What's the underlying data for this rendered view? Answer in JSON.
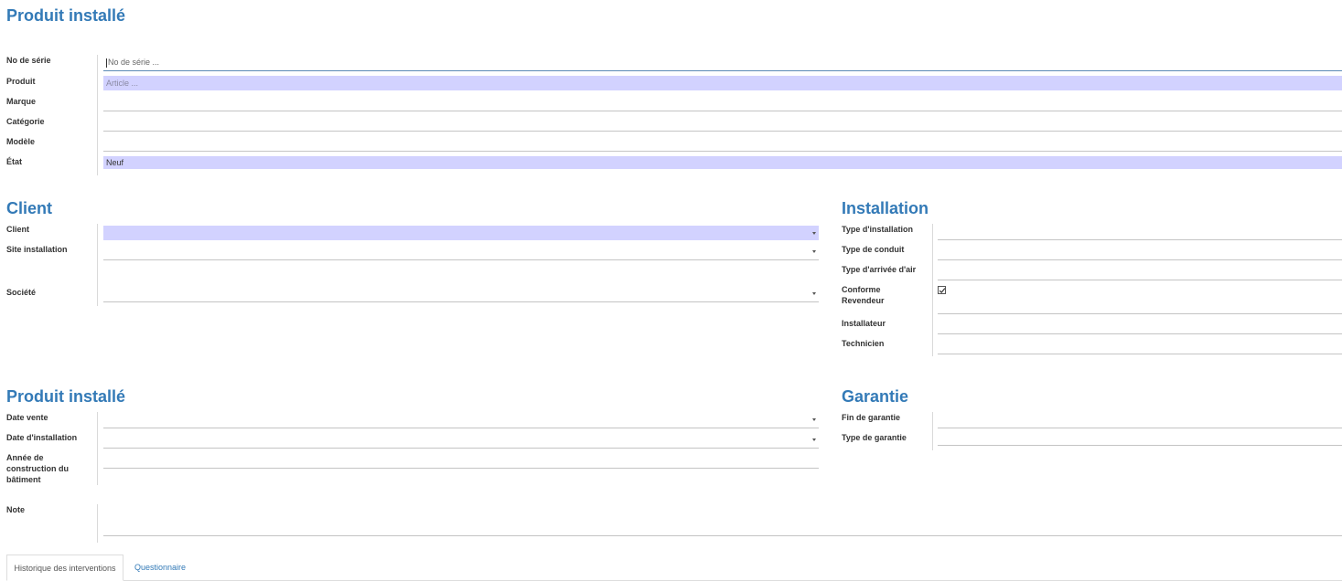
{
  "sections": {
    "product_main": "Produit installé",
    "client": "Client",
    "installation": "Installation",
    "product_sale": "Produit installé",
    "warranty": "Garantie"
  },
  "product": {
    "serial": {
      "label": "No de série",
      "placeholder": "No de série ..."
    },
    "product": {
      "label": "Produit",
      "placeholder": "Article ..."
    },
    "brand": {
      "label": "Marque",
      "value": ""
    },
    "category": {
      "label": "Catégorie",
      "value": ""
    },
    "model": {
      "label": "Modèle",
      "value": ""
    },
    "state": {
      "label": "État",
      "value": "Neuf"
    }
  },
  "client": {
    "client": {
      "label": "Client",
      "value": ""
    },
    "site": {
      "label": "Site installation",
      "value": ""
    },
    "company": {
      "label": "Société",
      "value": ""
    }
  },
  "installation": {
    "type": {
      "label": "Type d'installation",
      "value": ""
    },
    "duct": {
      "label": "Type de conduit",
      "value": ""
    },
    "air": {
      "label": "Type d'arrivée d'air",
      "value": ""
    },
    "dealer": {
      "label_line1": "Conforme",
      "label_line2": "Revendeur",
      "checked": true
    },
    "installer": {
      "label": "Installateur",
      "value": ""
    },
    "technician": {
      "label": "Technicien",
      "value": ""
    }
  },
  "sale": {
    "sale_date": {
      "label": "Date vente",
      "value": ""
    },
    "install_date": {
      "label": "Date d'installation",
      "value": ""
    },
    "build_year": {
      "label_line1": "Année de",
      "label_line2": "construction du",
      "label_line3": "bâtiment",
      "value": ""
    }
  },
  "warranty": {
    "end": {
      "label": "Fin de garantie",
      "value": ""
    },
    "type": {
      "label": "Type de garantie",
      "value": ""
    }
  },
  "note": {
    "label": "Note",
    "value": ""
  },
  "tabs": [
    {
      "label": "Historique des interventions",
      "active": true
    },
    {
      "label": "Questionnaire",
      "active": false
    }
  ],
  "colors": {
    "accent": "#337ab7",
    "required_bg": "#d2d2ff"
  }
}
